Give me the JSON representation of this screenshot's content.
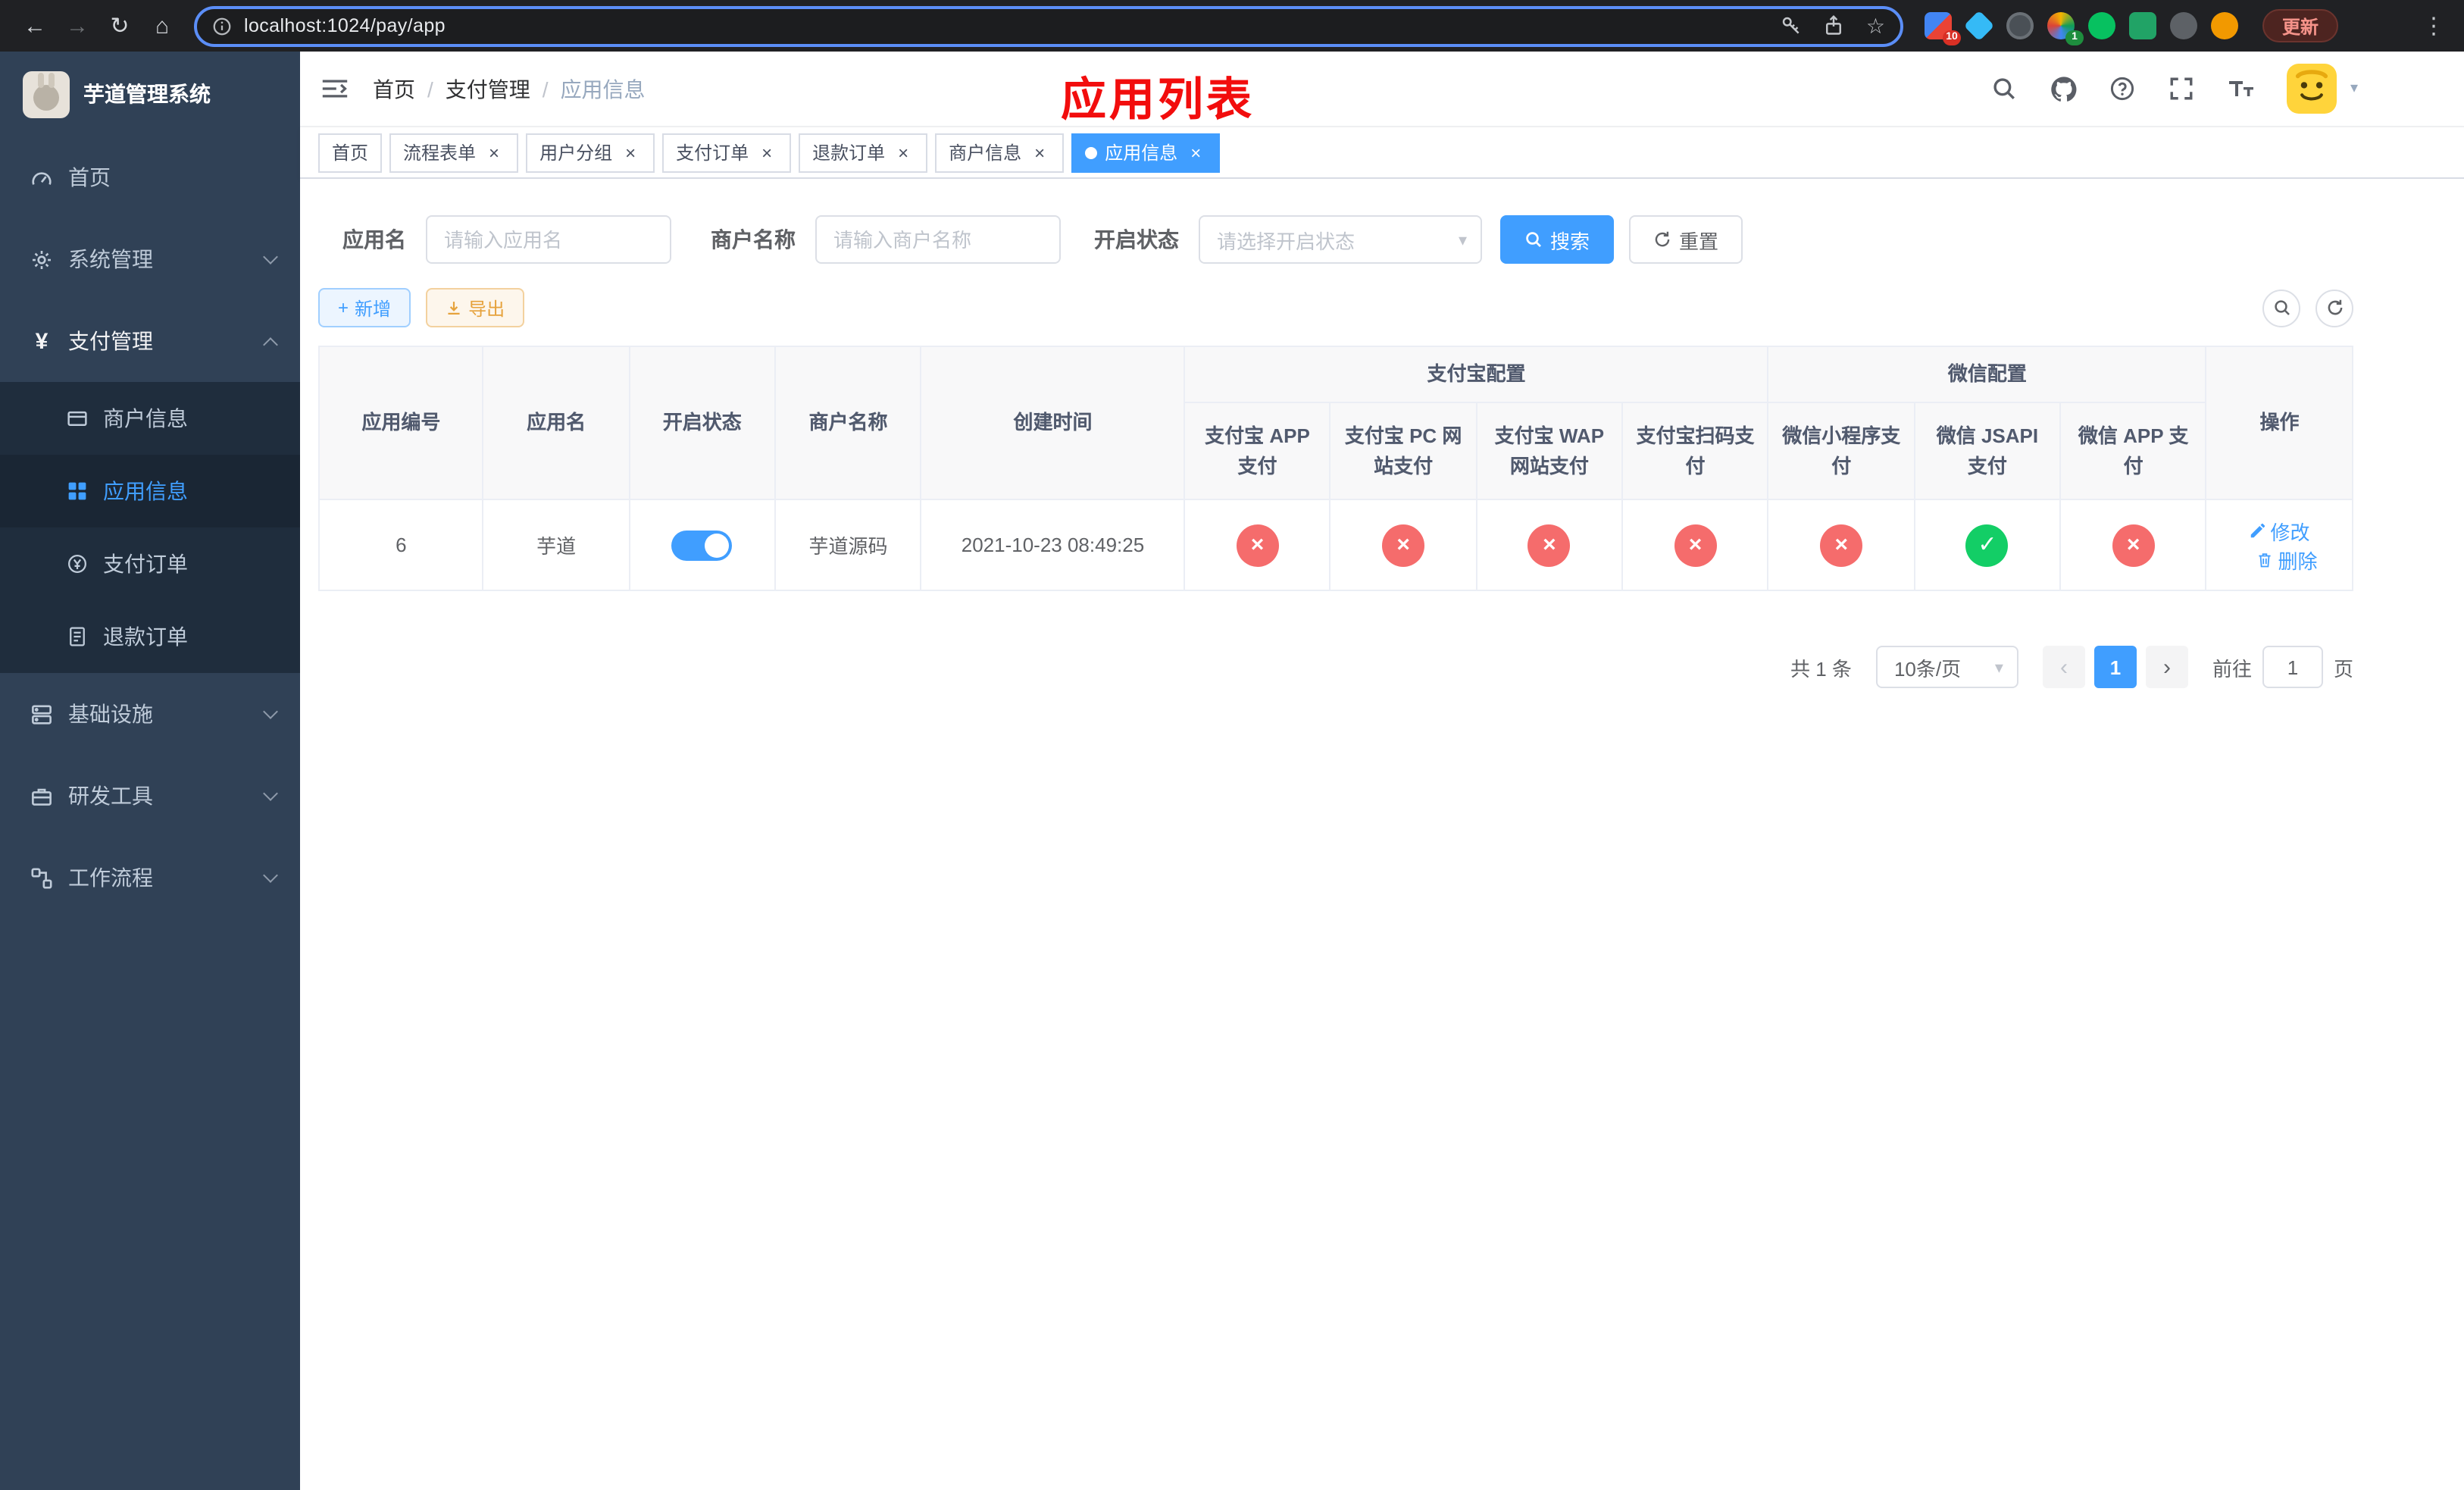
{
  "colors": {
    "primary": "#409eff",
    "success_circle": "#13ce66",
    "danger_circle": "#f56c6c",
    "sidebar_bg": "#304156",
    "submenu_bg": "#1f2d3d",
    "annotation_red": "#f20d0d",
    "warning": "#e6a23c"
  },
  "icons": {
    "back_arrow": "←",
    "forward_arrow": "→",
    "reload": "↻",
    "home": "⌂",
    "star": "☆",
    "menu_dots": "⋮",
    "tab_close": "×",
    "caret_down": "▾",
    "prev_page": "‹",
    "next_page": "›",
    "add_plus": "+",
    "check": "✓",
    "cross": "×"
  },
  "browser": {
    "url": "localhost:1024/pay/app",
    "update_button": "更新",
    "badge_red": "10",
    "badge_green": "1"
  },
  "annotation": "应用列表",
  "sidebar": {
    "title": "芋道管理系统",
    "items": {
      "home": "首页",
      "system": "系统管理",
      "pay": "支付管理",
      "merchant": "商户信息",
      "app": "应用信息",
      "order": "支付订单",
      "refund": "退款订单",
      "infra": "基础设施",
      "dev": "研发工具",
      "workflow": "工作流程"
    }
  },
  "breadcrumb": {
    "items": [
      "首页",
      "支付管理",
      "应用信息"
    ],
    "separator": "/"
  },
  "tabs": [
    {
      "label": "首页",
      "closable": false,
      "active": false
    },
    {
      "label": "流程表单",
      "closable": true,
      "active": false
    },
    {
      "label": "用户分组",
      "closable": true,
      "active": false
    },
    {
      "label": "支付订单",
      "closable": true,
      "active": false
    },
    {
      "label": "退款订单",
      "closable": true,
      "active": false
    },
    {
      "label": "商户信息",
      "closable": true,
      "active": false
    },
    {
      "label": "应用信息",
      "closable": true,
      "active": true
    }
  ],
  "filters": {
    "app_name_label": "应用名",
    "app_name_placeholder": "请输入应用名",
    "merchant_label": "商户名称",
    "merchant_placeholder": "请输入商户名称",
    "status_label": "开启状态",
    "status_placeholder": "请选择开启状态",
    "search_button": "搜索",
    "reset_button": "重置"
  },
  "toolbar": {
    "add": "新增",
    "export": "导出"
  },
  "table": {
    "groups": {
      "alipay": "支付宝配置",
      "wechat": "微信配置"
    },
    "columns": [
      "应用编号",
      "应用名",
      "开启状态",
      "商户名称",
      "创建时间",
      "支付宝 APP 支付",
      "支付宝 PC 网站支付",
      "支付宝 WAP 网站支付",
      "支付宝扫码支付",
      "微信小程序支付",
      "微信 JSAPI 支付",
      "微信 APP 支付",
      "操作"
    ],
    "rows": [
      {
        "app_id": "6",
        "app_name": "芋道",
        "status_on": true,
        "merchant": "芋道源码",
        "create_time": "2021-10-23 08:49:25",
        "configs": [
          "no",
          "no",
          "no",
          "no",
          "no",
          "yes",
          "no"
        ],
        "actions": [
          "修改",
          "删除"
        ]
      }
    ]
  },
  "pagination": {
    "total": "共 1 条",
    "page_size": "10条/页",
    "current_page": "1",
    "goto_label": "前往",
    "goto_value": "1",
    "goto_suffix": "页"
  }
}
